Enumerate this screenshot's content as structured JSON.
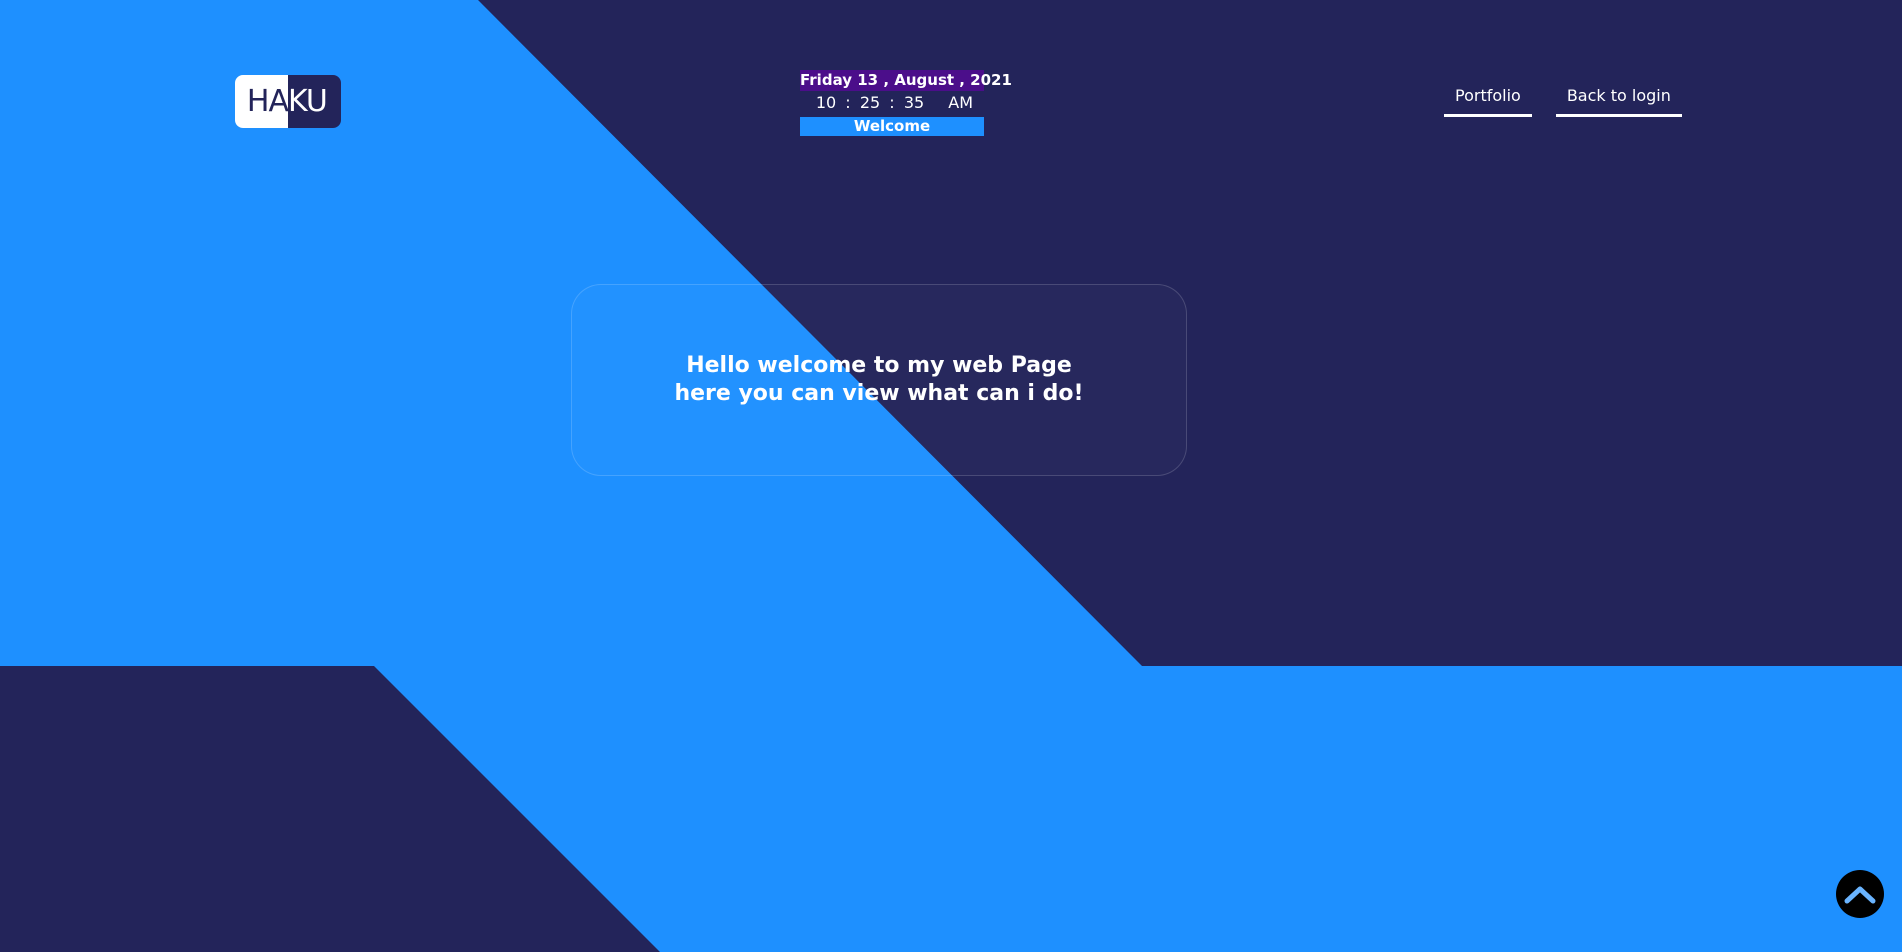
{
  "logo": {
    "left_text": "HA",
    "right_text": "KU"
  },
  "clock": {
    "date": "Friday 13 , August , 2021",
    "hours": "10",
    "sep1": ":",
    "minutes": "25",
    "sep2": ":",
    "seconds": "35",
    "ampm": "AM",
    "welcome": "Welcome"
  },
  "nav": {
    "items": [
      {
        "label": "Portfolio"
      },
      {
        "label": "Back to login"
      }
    ]
  },
  "hero": {
    "line1": "Hello welcome to my web Page",
    "line2": "here you can view what can i do!"
  },
  "icons": {
    "scroll_top": "chevron-up-icon"
  },
  "colors": {
    "dark_navy": "#23245a",
    "accent_blue": "#1e90ff",
    "date_bg": "#4b0e8a"
  }
}
